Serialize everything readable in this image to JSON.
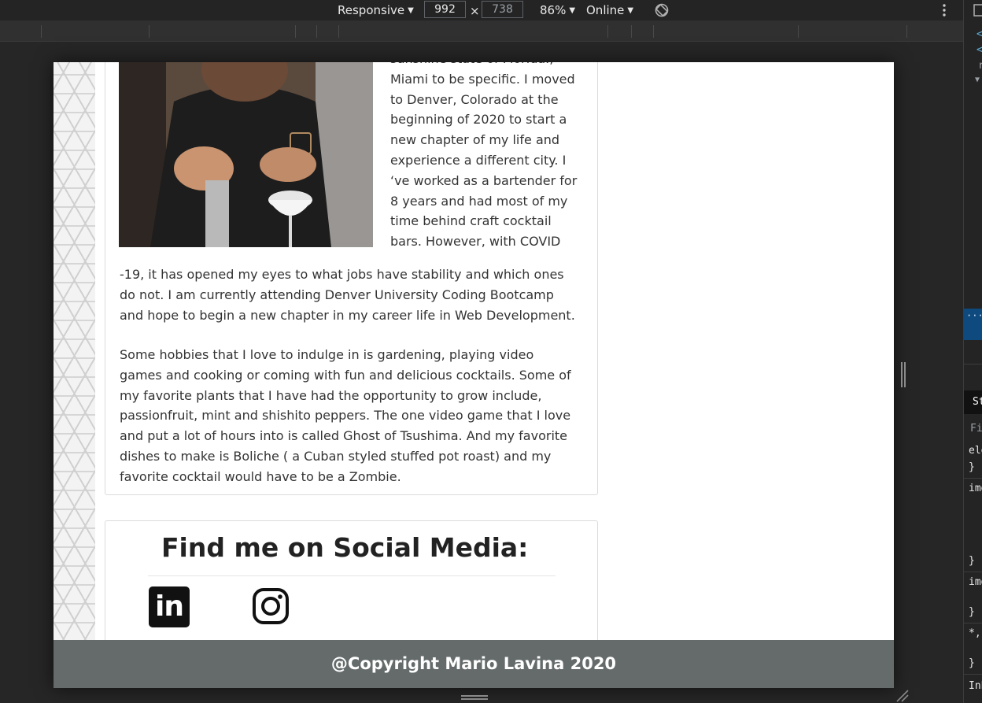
{
  "toolbar": {
    "device": "Responsive",
    "width": "992",
    "height": "738",
    "times": "×",
    "zoom": "86%",
    "network": "Online",
    "caret": "▼"
  },
  "about": {
    "para1_lines": [
      "sunshine state of Florida.,",
      "Miami to be specific. I moved",
      "to Denver, Colorado at the",
      "beginning of 2020 to start a",
      "new chapter of my life and",
      "experience a different city. I",
      "‘ve worked as a bartender for",
      "8 years and had most of my",
      "time behind craft cocktail",
      "bars. However, with COVID"
    ],
    "para1_rest": "-19, it has opened my eyes to what jobs have stability and which ones do not. I am currently attending Denver University Coding Bootcamp and hope to begin a new chapter in my career life in Web Development.",
    "para2": "Some hobbies that I love to indulge in is gardening, playing video games and cooking or coming with fun and delicious cocktails. Some of my favorite plants that I have had the opportunity to grow include, passionfruit, mint and shishito peppers. The one video game that I love and put a lot of hours into is called Ghost of Tsushima. And my favorite dishes to make is Boliche ( a Cuban styled stuffed pot roast) and my favorite cocktail would have to be a Zombie."
  },
  "social": {
    "title": "Find me on Social Media:",
    "linkedin_text": "in"
  },
  "footer": {
    "text": "@Copyright Mario Lavina 2020"
  },
  "devtools": {
    "lines": [
      "<",
      "<",
      "r",
      "▼",
      "}",
      "}",
      "}",
      "}"
    ],
    "ellipsis": "···",
    "styles_tab": "St",
    "filter_placeholder": "Fil",
    "rule1": "ele",
    "rule2": "img",
    "rule3": "img",
    "rule4": "*,",
    "inherited": "Inh"
  },
  "colors": {
    "footer_bg": "#656b6b",
    "selected_row": "#0e4a7d",
    "toolbar_bg": "#242424"
  }
}
